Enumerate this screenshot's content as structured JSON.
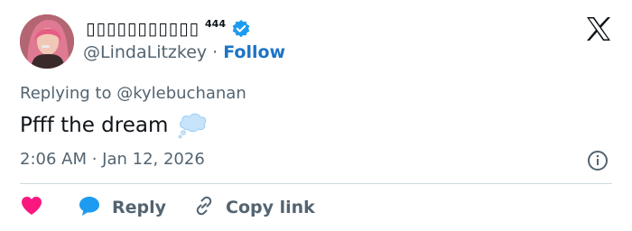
{
  "tweet": {
    "display_name": "▯▯▯▯▯▯▯▯▯▯▯",
    "name_superscript": "444",
    "handle": "@LindaLitzkey",
    "separator": "·",
    "follow_label": "Follow",
    "replying_prefix": "Replying to ",
    "replying_to": "@kylebuchanan",
    "text": "Pfff the dream",
    "timestamp": "2:06 AM · Jan 12, 2026"
  },
  "actions": {
    "reply_label": "Reply",
    "copy_link_label": "Copy link"
  },
  "colors": {
    "accent": "#1d9bf0",
    "follow": "#1d74c5",
    "heart": "#f91880",
    "secondary_text": "#536471",
    "divider": "#cfd9de"
  },
  "icons": [
    "x-logo-icon",
    "verified-badge-icon",
    "thought-balloon-icon",
    "info-icon",
    "heart-icon",
    "reply-bubble-icon",
    "link-icon"
  ]
}
